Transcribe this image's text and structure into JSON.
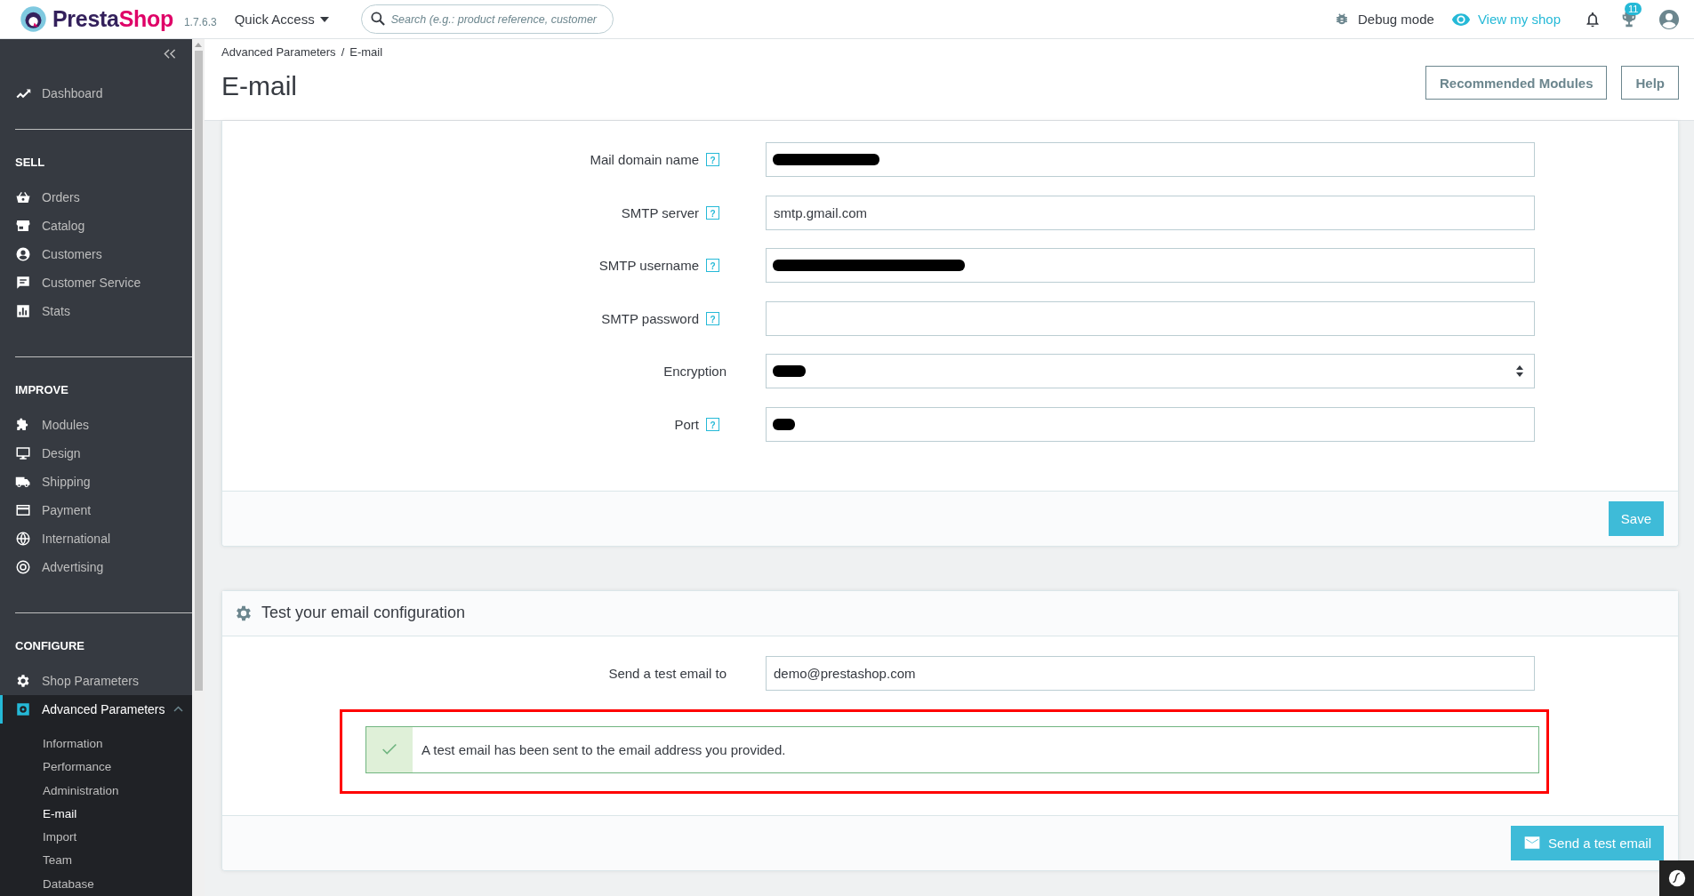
{
  "topbar": {
    "logo": {
      "part_1": "Presta",
      "part_2": "Shop"
    },
    "version": "1.7.6.3",
    "quick_access": "Quick Access",
    "search": {
      "placeholder": "Search (e.g.: product reference, customer"
    },
    "debug": "Debug mode",
    "view_shop": "View my shop",
    "notifications_badge": "11"
  },
  "sidebar": {
    "top_items": [
      {
        "label": "Dashboard",
        "selected": false
      }
    ],
    "sections": [
      {
        "heading": "SELL",
        "items": [
          {
            "label": "Orders",
            "selected": false
          },
          {
            "label": "Catalog",
            "selected": false
          },
          {
            "label": "Customers",
            "selected": false
          },
          {
            "label": "Customer Service",
            "selected": false
          },
          {
            "label": "Stats",
            "selected": false
          }
        ]
      },
      {
        "heading": "IMPROVE",
        "items": [
          {
            "label": "Modules",
            "selected": false
          },
          {
            "label": "Design",
            "selected": false
          },
          {
            "label": "Shipping",
            "selected": false
          },
          {
            "label": "Payment",
            "selected": false
          },
          {
            "label": "International",
            "selected": false
          },
          {
            "label": "Advertising",
            "selected": false
          }
        ]
      },
      {
        "heading": "CONFIGURE",
        "items": [
          {
            "label": "Shop Parameters",
            "selected": false
          },
          {
            "label": "Advanced Parameters",
            "selected": true,
            "expanded": true,
            "children": [
              {
                "label": "Information",
                "selected": false
              },
              {
                "label": "Performance",
                "selected": false
              },
              {
                "label": "Administration",
                "selected": false
              },
              {
                "label": "E-mail",
                "selected": true
              },
              {
                "label": "Import",
                "selected": false
              },
              {
                "label": "Team",
                "selected": false
              },
              {
                "label": "Database",
                "selected": false
              }
            ]
          }
        ]
      }
    ]
  },
  "header": {
    "breadcrumb": {
      "items": [
        "Advanced Parameters",
        "E-mail"
      ],
      "separator": "/"
    },
    "title": "E-mail",
    "buttons": [
      "Recommended Modules",
      "Help"
    ]
  },
  "smtp_form": {
    "fields": [
      {
        "label": "Mail domain name",
        "help": "?",
        "kind": "text",
        "redacted": true
      },
      {
        "label": "SMTP server",
        "help": "?",
        "kind": "text",
        "value": "smtp.gmail.com",
        "redacted": false
      },
      {
        "label": "SMTP username",
        "help": "?",
        "kind": "text",
        "redacted": true
      },
      {
        "label": "SMTP password",
        "help": "?",
        "kind": "text",
        "redacted": false
      },
      {
        "label": "Encryption",
        "kind": "select",
        "redacted": true
      },
      {
        "label": "Port",
        "help": "?",
        "kind": "text",
        "redacted": true
      }
    ],
    "save_button": "Save"
  },
  "test_panel": {
    "title": "Test your email configuration",
    "field": {
      "label": "Send a test email to",
      "value": "demo@prestashop.com"
    },
    "alert": {
      "kind": "success",
      "text": "A test email has been sent to the email address you provided.",
      "highlighted": true
    },
    "button": "Send a test email"
  }
}
